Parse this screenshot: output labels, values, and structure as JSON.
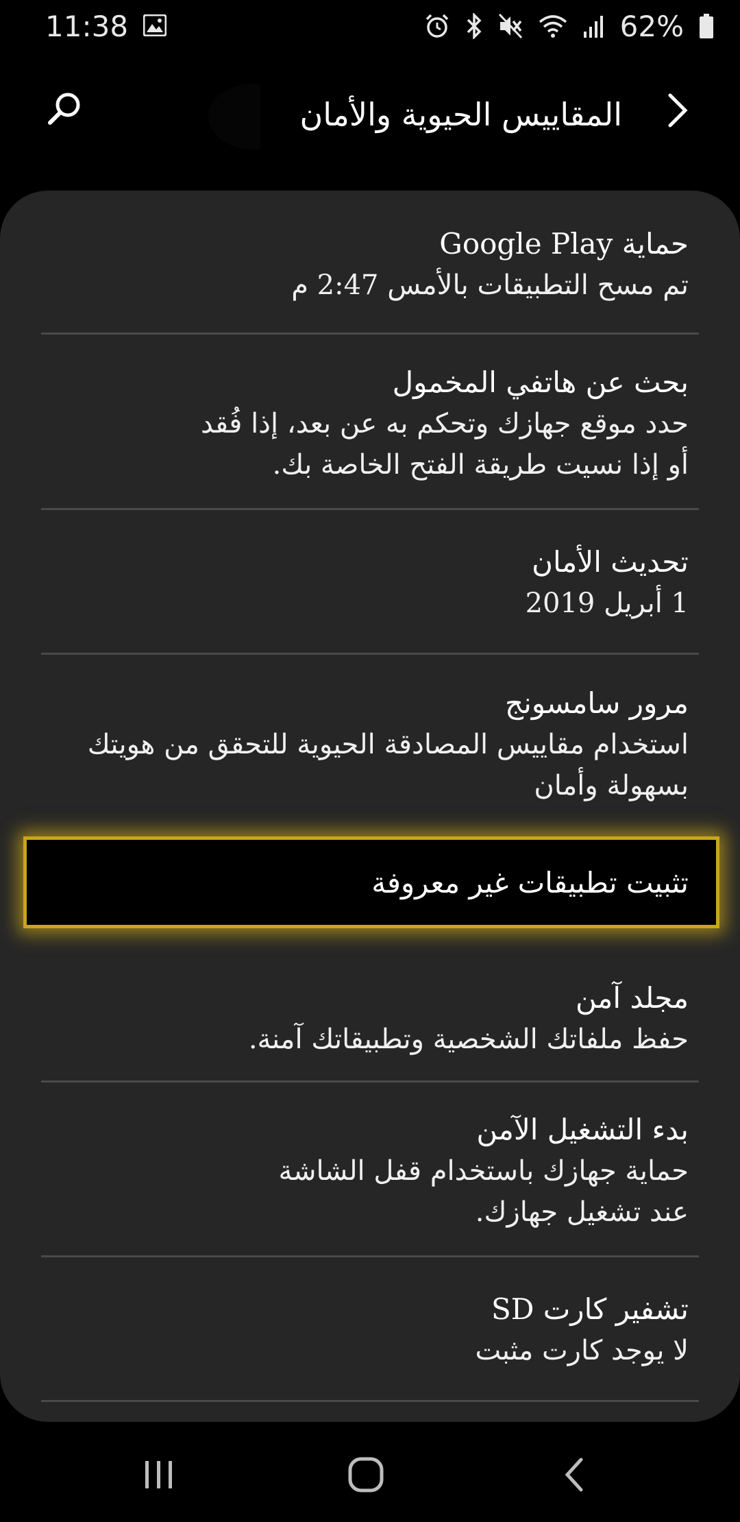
{
  "status_bar": {
    "time": "11:38",
    "battery": "62%",
    "icons": [
      "gallery-icon",
      "alarm-icon",
      "bluetooth-icon",
      "mute-icon",
      "wifi-icon",
      "signal-icon",
      "battery-icon"
    ]
  },
  "header": {
    "title": "المقاييس الحيوية والأمان",
    "search_icon": "search-icon",
    "back_icon": "chevron-right-icon"
  },
  "items": [
    {
      "title": "حماية Google Play",
      "subtitle": "تم مسح التطبيقات بالأمس 2:47 م"
    },
    {
      "title": "بحث عن هاتفي المخمول",
      "subtitle_lines": [
        "حدد موقع جهازك وتحكم به عن بعد، إذا فُقد",
        "أو إذا نسيت طريقة الفتح الخاصة بك."
      ]
    },
    {
      "title": "تحديث الأمان",
      "subtitle": "1 أبريل 2019"
    },
    {
      "title": "مرور سامسونج",
      "subtitle_lines": [
        "استخدام مقاييس المصادقة الحيوية للتحقق من هويتك",
        "بسهولة وأمان"
      ]
    },
    {
      "title": "تثبيت تطبيقات غير معروفة"
    },
    {
      "title": "مجلد آمن",
      "subtitle": "حفظ ملفاتك الشخصية وتطبيقاتك آمنة."
    },
    {
      "title": "بدء التشغيل الآمن",
      "subtitle_lines": [
        "حماية جهازك باستخدام قفل الشاشة",
        "عند تشغيل جهازك."
      ]
    },
    {
      "title": "تشفير كارت SD",
      "subtitle": "لا يوجد كارت مثبت"
    }
  ],
  "navbar": {
    "icons": [
      "recent-apps-icon",
      "home-icon",
      "back-icon"
    ]
  },
  "colors": {
    "background": "#000000",
    "card": "#262626",
    "divider": "#4a4a4a",
    "highlight_border": "#c9a61a"
  }
}
